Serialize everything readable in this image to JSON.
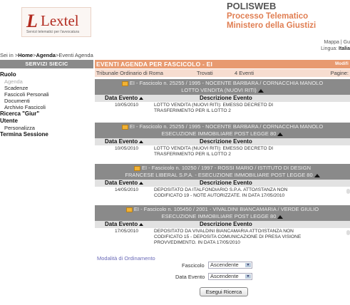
{
  "header": {
    "logo_text": "Lextel",
    "logo_mark": "L",
    "logo_sub": "Servizi telematici per l'avvocatura",
    "app_title": "POLISWEB",
    "app_sub1": "Processo Telematico",
    "app_sub2": "Ministero della Giustizi"
  },
  "topbar": {
    "mappa": "Mappa | Gu",
    "lingua_label": "Lingua:",
    "lingua_value": "Italia"
  },
  "breadcrumb": {
    "prefix": "Sei in >",
    "home": "Home",
    "sep1": ">",
    "agenda": "Agenda",
    "sep2": ">",
    "rest": "Eventi Agenda"
  },
  "sidebar": {
    "title": "SERVIZI SIECIC",
    "sections": [
      {
        "label": "Ruolo",
        "items": [
          {
            "label": "Agenda",
            "active": true
          },
          {
            "label": "Scadenze"
          },
          {
            "label": "Fascicoli Personali"
          },
          {
            "label": "Documenti"
          },
          {
            "label": "Archivio Fascicoli"
          }
        ]
      },
      {
        "label": "Ricerca \"Giur\"",
        "items": []
      },
      {
        "label": "Utente",
        "items": [
          {
            "label": "Personalizza"
          }
        ]
      },
      {
        "label": "Termina Sessione",
        "items": []
      }
    ]
  },
  "main": {
    "title": "EVENTI AGENDA PER FASCICOLO - EI",
    "modifica": "Modifi",
    "tribunale": "Tribunale Ordinario di Roma",
    "trovati_label": "Trovati",
    "trovati_value": "4 Eventi",
    "pagine_label": "Pagine:"
  },
  "columns": {
    "data": "Data Evento",
    "descrizione": "Descrizione Evento"
  },
  "fascicoli": [
    {
      "line1": "EI - Fascicolo n. 25255 / 1995 - NOCENTE BARBARA / CORNACCHIA MANOLO",
      "line2": "LOTTO VENDITA (NUOVI RITI)",
      "date": "10/05/2010",
      "desc1": "LOTTO VENDITA (NUOVI RITI): EMESSO DECRETO DI",
      "desc2": "TRASFERIMENTO PER IL LOTTO 2",
      "desc3": ""
    },
    {
      "line1": "EI - Fascicolo n. 25255 / 1995 - NOCENTE BARBARA / CORNACCHIA MANOLO",
      "line2": "ESECUZIONE IMMOBILIARE POST LEGGE 80",
      "date": "10/05/2010",
      "desc1": "LOTTO VENDITA (NUOVI RITI): EMESSO DECRETO DI",
      "desc2": "TRASFERIMENTO PER IL LOTTO 2",
      "desc3": ""
    },
    {
      "line1": "EI - Fascicolo n. 10250 / 1997 - ROSSI MARIO / ISTITUTO DI DESIGN",
      "line2": "FRANCESE LIBERAL S.P.A. - ESECUZIONE IMMOBILIARE POST LEGGE 80",
      "date": "14/05/2010",
      "desc1": "DEPOSITATO DA ITALFONDIARIO S.P.A. ATTO/ISTANZA NON",
      "desc2": "CODIFICATO 19 - NOTE AUTORIZZATE. IN DATA 17/05/2010",
      "desc3": ""
    },
    {
      "line1": "EI - Fascicolo n. 105450 / 2001 - VIVALDINI BIANCAMARIA / VERDE GIULIO",
      "line2": "ESECUZIONE IMMOBILIARE POST LEGGE 80",
      "date": "17/05/2010",
      "desc1": "DEPOSITATO DA VIVALDINI BIANCAMARIA ATTO/ISTANZA NON",
      "desc2": "CODIFICATO 15 - DEPOSITA COMUNICAZIONE DI PRESA VISIONE",
      "desc3": "PROVVEDIMENTO. IN DATA 17/05/2010"
    }
  ],
  "sort": {
    "label": "Modalità di Ordinamento",
    "fascicolo_label": "Fascicolo",
    "fascicolo_value": "Ascendente",
    "data_label": "Data Evento",
    "data_value": "Ascendente",
    "button": "Esegui Ricerca"
  },
  "colors": {
    "accent": "#e89a70",
    "header_gray": "#8a8a8a",
    "brand_red": "#b22a1f"
  }
}
